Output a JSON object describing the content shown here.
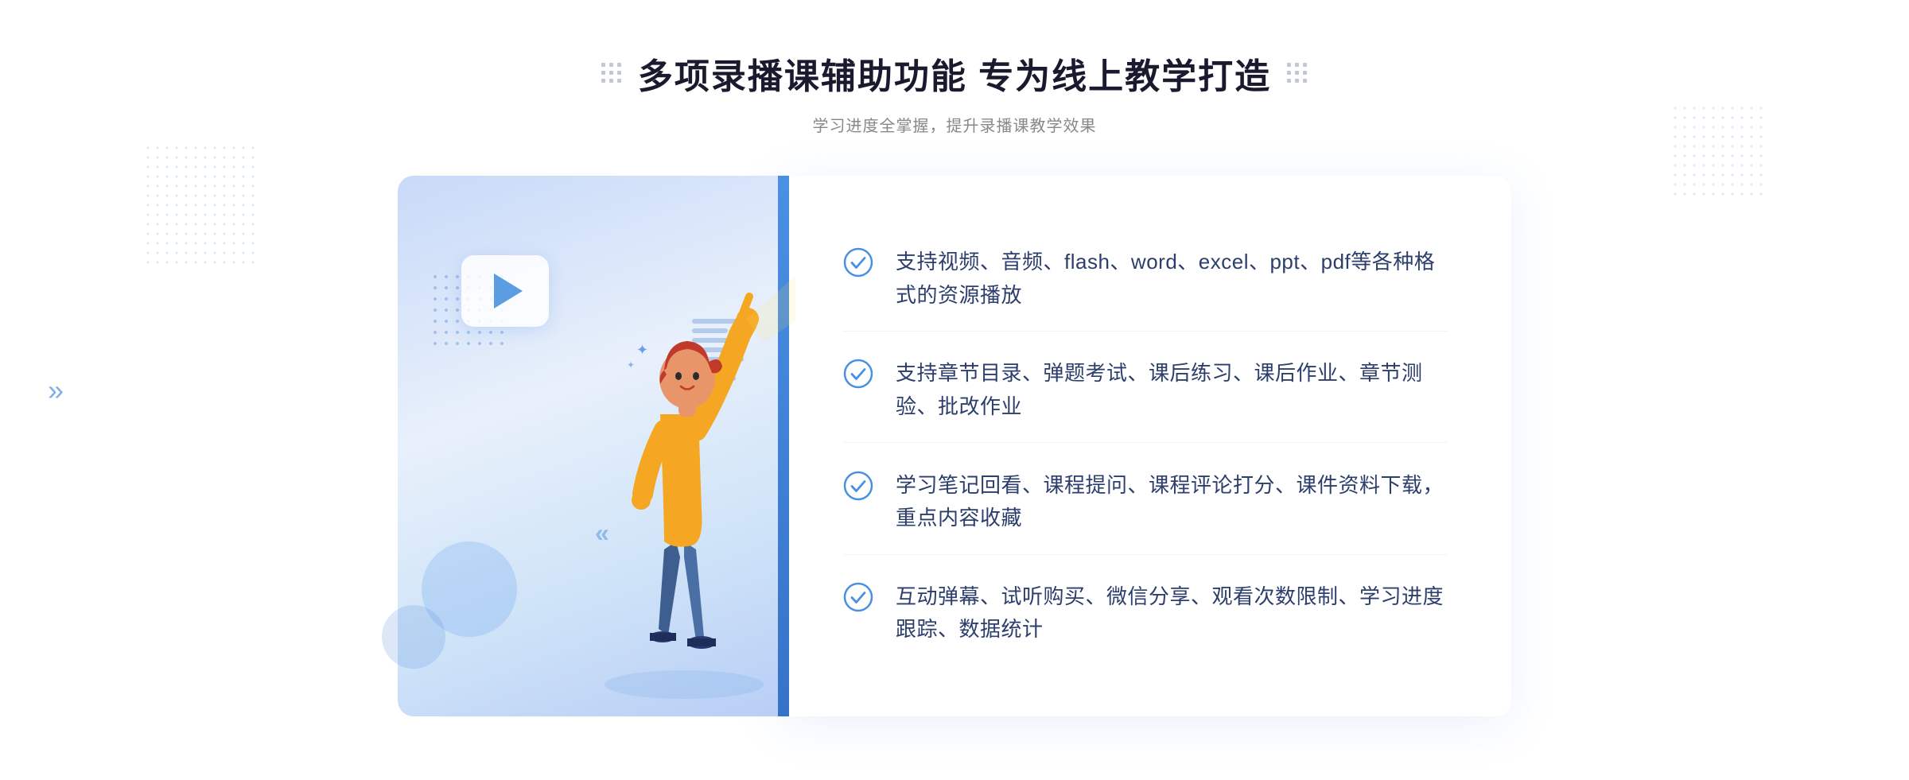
{
  "header": {
    "main_title": "多项录播课辅助功能 专为线上教学打造",
    "sub_title": "学习进度全掌握，提升录播课教学效果"
  },
  "features": [
    {
      "id": "feature-1",
      "text": "支持视频、音频、flash、word、excel、ppt、pdf等各种格式的资源播放"
    },
    {
      "id": "feature-2",
      "text": "支持章节目录、弹题考试、课后练习、课后作业、章节测验、批改作业"
    },
    {
      "id": "feature-3",
      "text": "学习笔记回看、课程提问、课程评论打分、课件资料下载，重点内容收藏"
    },
    {
      "id": "feature-4",
      "text": "互动弹幕、试听购买、微信分享、观看次数限制、学习进度跟踪、数据统计"
    }
  ],
  "colors": {
    "primary": "#4a90e2",
    "title": "#1a1a2e",
    "text": "#2c3e6b",
    "subtitle": "#888888",
    "check": "#4a90e2"
  },
  "decorations": {
    "chevron": "»"
  }
}
